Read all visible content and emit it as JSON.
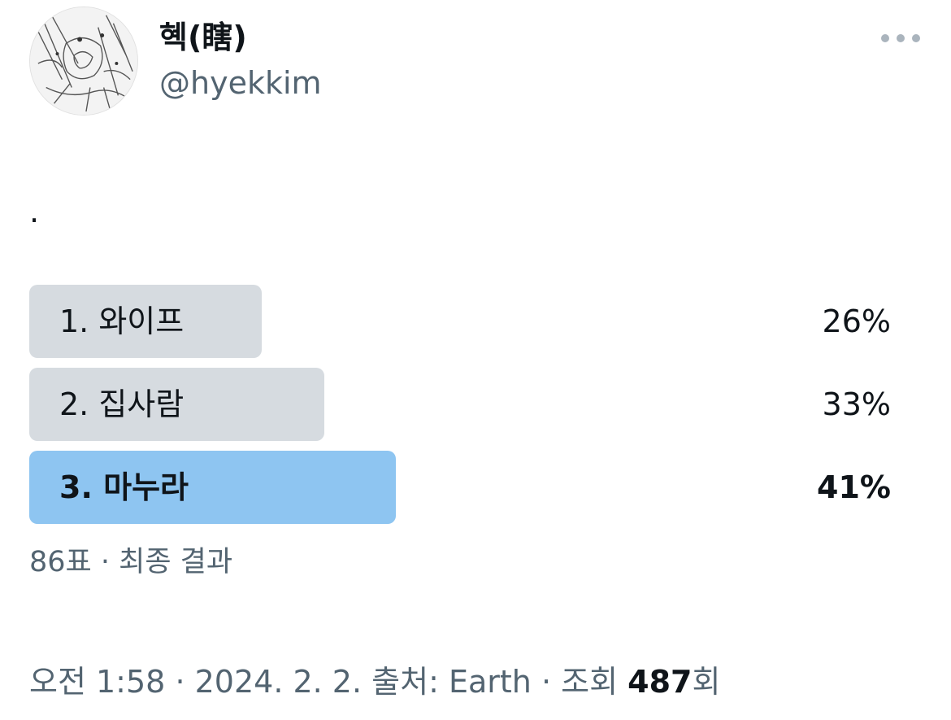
{
  "author": {
    "display_name": "혝(瞎)",
    "handle": "@hyekkim",
    "avatar_icon": "manga-sketch-avatar"
  },
  "menu": {
    "icon": "more-dots-icon"
  },
  "tweet": {
    "text": "."
  },
  "poll": {
    "options": [
      {
        "label": "1. 와이프",
        "percent_text": "26%",
        "percent": 26,
        "winner": false
      },
      {
        "label": "2. 집사람",
        "percent_text": "33%",
        "percent": 33,
        "winner": false
      },
      {
        "label": "3. 마누라",
        "percent_text": "41%",
        "percent": 41,
        "winner": true
      }
    ],
    "summary": "86표 · 최종 결과"
  },
  "meta": {
    "time": "오전 1:58",
    "date": "2024. 2. 2.",
    "source": "출처: Earth",
    "views_prefix": "조회",
    "views_count": "487",
    "views_suffix": "회"
  },
  "colors": {
    "bar": "#d6dbe0",
    "winner_bar": "#8ec5f1",
    "text": "#0f1419",
    "secondary_text": "#536471"
  }
}
